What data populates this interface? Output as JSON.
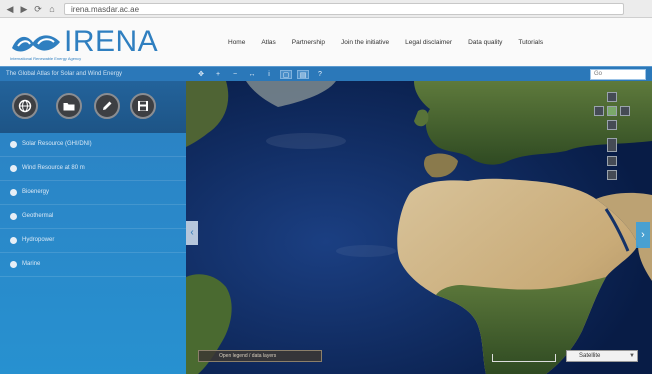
{
  "browser": {
    "url": "irena.masdar.ac.ae",
    "back_glyph": "◀",
    "forward_glyph": "▶",
    "reload_glyph": "⟳",
    "home_glyph": "⌂"
  },
  "header": {
    "logo_text": "IRENA",
    "logo_sub": "International Renewable Energy Agency",
    "nav": [
      "Home",
      "Atlas",
      "Partnership",
      "Join the initiative",
      "Legal disclaimer",
      "Data quality",
      "Tutorials"
    ]
  },
  "toolbar": {
    "title": "The Global Atlas for Solar and Wind Energy",
    "search_placeholder": "Go"
  },
  "sidebar": {
    "tool_buttons": [
      {
        "icon": "globe-icon"
      },
      {
        "icon": "folder-icon"
      },
      {
        "icon": "edit-icon"
      },
      {
        "icon": "save-icon"
      }
    ],
    "layers": [
      "Solar Resource (GHI/DNI)",
      "Wind Resource at 80 m",
      "Bioenergy",
      "Geothermal",
      "Hydropower",
      "Marine"
    ]
  },
  "map": {
    "legend_label": "Open legend / data layers",
    "basemap_selected": "Satellite"
  },
  "colors": {
    "brand_blue": "#2f7fc0",
    "toolbar_blue": "#2b78b9",
    "panel_blue": "#2a88c9",
    "ocean": "#0b2456"
  }
}
